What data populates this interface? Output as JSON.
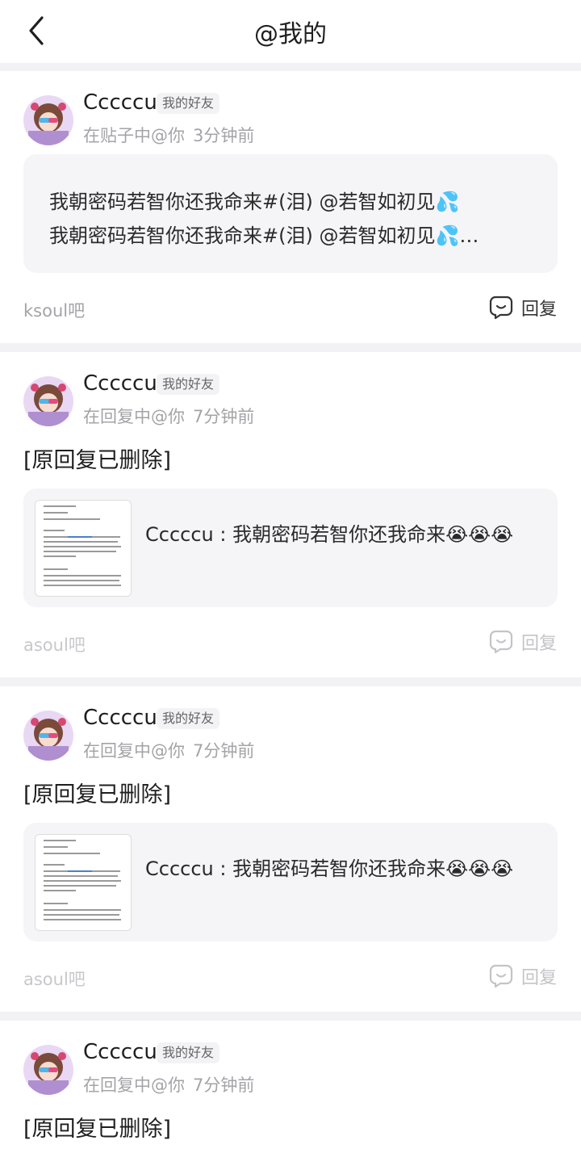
{
  "header": {
    "title": "@我的"
  },
  "notifications": [
    {
      "username": "Cccccu",
      "badge": "我的好友",
      "context": "在贴子中@你",
      "time": "3分钟前",
      "quote_lines": [
        "我朝密码若智你还我命来#(泪) @若智如初见💦",
        "我朝密码若智你还我命来#(泪) @若智如初见💦…"
      ],
      "forum": "ksoul吧",
      "reply_label": "回复"
    },
    {
      "username": "Cccccu",
      "badge": "我的好友",
      "context": "在回复中@你",
      "time": "7分钟前",
      "deleted_text": "[原回复已删除]",
      "reply_snippet": "Cccccu : 我朝密码若智你还我命来😭😭😭",
      "forum": "asoul吧",
      "reply_label": "回复"
    },
    {
      "username": "Cccccu",
      "badge": "我的好友",
      "context": "在回复中@你",
      "time": "7分钟前",
      "deleted_text": "[原回复已删除]",
      "reply_snippet": "Cccccu : 我朝密码若智你还我命来😭😭😭",
      "forum": "asoul吧",
      "reply_label": "回复"
    },
    {
      "username": "Cccccu",
      "badge": "我的好友",
      "context": "在回复中@你",
      "time": "7分钟前",
      "deleted_text": "[原回复已删除]"
    }
  ],
  "icons": {
    "back": "chevron-left-icon",
    "reply": "comment-bubble-icon"
  },
  "colors": {
    "meta": "#a4a4a8",
    "quote_bg": "#f5f5f8",
    "divider": "#f2f2f5"
  }
}
